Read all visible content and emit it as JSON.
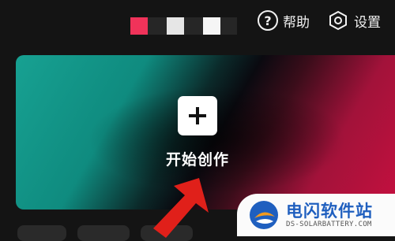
{
  "header": {
    "help_label": "帮助",
    "settings_label": "设置",
    "help_icon": "question-circle-icon",
    "settings_icon": "hexagon-gear-icon",
    "logo_colors": [
      "#f0335a",
      "#e6e6e6",
      "#f5f5f5"
    ]
  },
  "main": {
    "create_label": "开始创作",
    "create_icon": "plus-icon",
    "gradient_colors": [
      "#17a192",
      "#0a0a10",
      "#c7103f"
    ]
  },
  "watermark": {
    "title": "电闪软件站",
    "subtitle": "DS-SOLARBATTERY.COM",
    "brand_color": "#1f5fbf"
  },
  "annotation": {
    "arrow_color": "#e0201a"
  }
}
